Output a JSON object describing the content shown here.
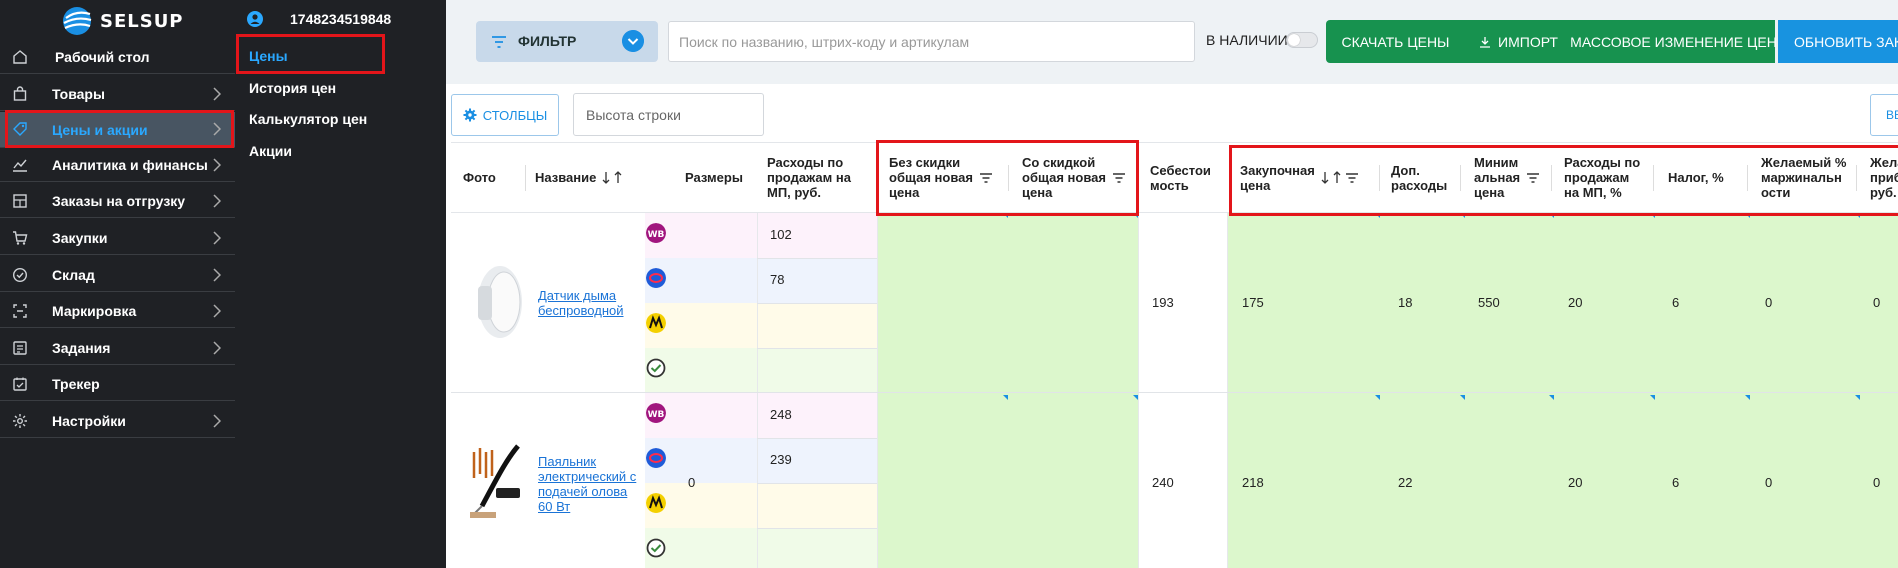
{
  "app": {
    "logo_text": "SELSUP",
    "user_id": "1748234519848"
  },
  "sidebar": {
    "items": [
      {
        "label": "Рабочий стол",
        "icon": "home-icon",
        "chevron": false
      },
      {
        "label": "Товары",
        "icon": "bag-icon",
        "chevron": true
      },
      {
        "label": "Цены и акции",
        "icon": "tag-icon",
        "chevron": true,
        "active": true
      },
      {
        "label": "Аналитика и финансы",
        "icon": "chart-icon",
        "chevron": true
      },
      {
        "label": "Заказы на отгрузку",
        "icon": "box-icon",
        "chevron": true
      },
      {
        "label": "Закупки",
        "icon": "cart-icon",
        "chevron": true
      },
      {
        "label": "Склад",
        "icon": "check-circle-icon",
        "chevron": true
      },
      {
        "label": "Маркировка",
        "icon": "barcode-icon",
        "chevron": true
      },
      {
        "label": "Задания",
        "icon": "tasks-icon",
        "chevron": true
      },
      {
        "label": "Трекер",
        "icon": "tracker-icon",
        "chevron": false
      },
      {
        "label": "Настройки",
        "icon": "gear-icon",
        "chevron": true
      }
    ]
  },
  "submenu": {
    "items": [
      {
        "label": "Цены",
        "active": true
      },
      {
        "label": "История цен"
      },
      {
        "label": "Калькулятор цен"
      },
      {
        "label": "Акции"
      }
    ]
  },
  "toolbar": {
    "filter_label": "ФИЛЬТР",
    "search_placeholder": "Поиск по названию, штрих-коду и артикулам",
    "instock_label": "В НАЛИЧИИ",
    "download_label": "СКАЧАТЬ ЦЕНЫ",
    "import_label": "ИМПОРТ",
    "mass_label": "МАССОВОЕ ИЗМЕНЕНИЕ ЦЕН",
    "update_label": "ОБНОВИТЬ ЗАКУ",
    "columns_label": "СТОЛБЦЫ",
    "row_height_placeholder": "Высота строки",
    "right_btn_label": "ВЕ"
  },
  "table": {
    "headers": {
      "photo": "Фото",
      "name": "Название",
      "sizes": "Размеры",
      "mp_costs": [
        "Расходы по",
        "продажам на",
        "МП, руб."
      ],
      "no_discount": [
        "Без скидки",
        "общая новая",
        "цена"
      ],
      "with_discount": [
        "Со скидкой",
        "общая новая",
        "цена"
      ],
      "cost": [
        "Себестои",
        "мость"
      ],
      "purchase": [
        "Закупочная",
        "цена"
      ],
      "extra": [
        "Доп.",
        "расходы"
      ],
      "min_price": [
        "Миним",
        "альная",
        "цена"
      ],
      "mp_pct": [
        "Расходы по",
        "продажам",
        "на МП, %"
      ],
      "tax": "Налог, %",
      "margin": [
        "Желаемый %",
        "маржинальн",
        "ости"
      ],
      "profit": [
        "Жела",
        "приб",
        "руб."
      ]
    },
    "rows": [
      {
        "name": [
          "Датчик дыма",
          "беспроводной"
        ],
        "size": "",
        "mp": {
          "wb": "102",
          "ozon": "78",
          "yandex": "",
          "sber": ""
        },
        "cost": "193",
        "purchase": "175",
        "extra": "18",
        "min_price": "550",
        "mp_pct": "20",
        "tax": "6",
        "margin": "0",
        "profit": "0"
      },
      {
        "name": [
          "Паяльник",
          "электрический с",
          "подачей олова",
          "60 Вт"
        ],
        "size": "0",
        "mp": {
          "wb": "248",
          "ozon": "239",
          "yandex": "",
          "sber": ""
        },
        "cost": "240",
        "purchase": "218",
        "extra": "22",
        "min_price": "",
        "mp_pct": "20",
        "tax": "6",
        "margin": "0",
        "profit": "0"
      }
    ],
    "marketplaces": [
      {
        "code": "WB",
        "icon": "wildberries-icon",
        "color": "#a1157e"
      },
      {
        "code": "",
        "icon": "ozon-icon",
        "color": "#1f5bd8"
      },
      {
        "code": "",
        "icon": "yandex-market-icon",
        "color": "#f4d000"
      },
      {
        "code": "",
        "icon": "sbermarket-icon",
        "color": "#3a8b3f"
      }
    ]
  },
  "colors": {
    "sidebar_bg": "#1f2125",
    "accent": "#1a8fe3",
    "green_btn": "#17924f",
    "highlight_green": "#dcf7cc",
    "annotation_red": "#e3151a"
  }
}
